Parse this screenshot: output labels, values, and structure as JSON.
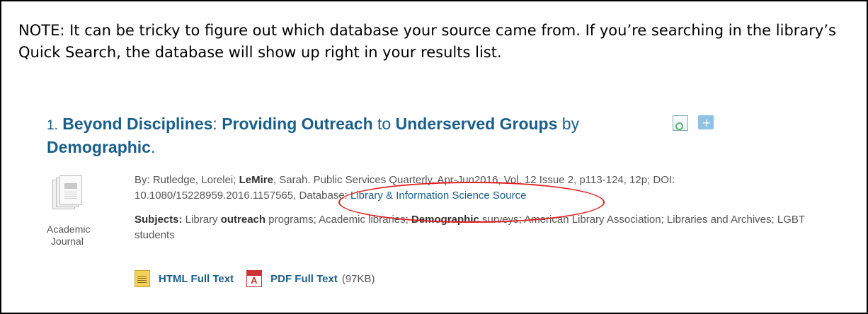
{
  "note": {
    "text": "NOTE:  It can be tricky to figure out which database your source came from.  If you’re searching in the library’s Quick Search, the database will show up right in your results list."
  },
  "result": {
    "number": "1.",
    "title_parts": [
      {
        "text": "Beyond Disciplines",
        "bold": true
      },
      {
        "text": ": ",
        "bold": false
      },
      {
        "text": "Providing Outreach",
        "bold": true
      },
      {
        "text": " to ",
        "bold": false
      },
      {
        "text": "Underserved Groups",
        "bold": true
      },
      {
        "text": " by ",
        "bold": false
      },
      {
        "text": "Demographic",
        "bold": true
      },
      {
        "text": ".",
        "bold": false
      }
    ],
    "publication_type": "Academic Journal",
    "by_label": "By: ",
    "author1": "Rutledge, Lorelei; ",
    "author2": "LeMire",
    "author2_rest": ", Sarah. Public Services Quarterly, Apr-Jun2016, Vol. 12 Issue 2, p113-124, 12p; DOI: 10.1080/15228959.2016.1157565, Database: ",
    "database": "Library & Information Science Source",
    "subjects_label": "Subjects:",
    "subjects_parts": [
      {
        "text": " Library ",
        "bold": false
      },
      {
        "text": "outreach",
        "bold": true
      },
      {
        "text": " programs; Academic libraries; ",
        "bold": false
      },
      {
        "text": "Demographic",
        "bold": true
      },
      {
        "text": " surveys; American Library Association; Libraries and Archives; LGBT students",
        "bold": false
      }
    ],
    "html_link": "HTML Full Text",
    "pdf_link": "PDF Full Text",
    "pdf_size": "(97KB)"
  },
  "annotation": {
    "color": "#e02020"
  },
  "colors": {
    "link": "#1a5e8a",
    "text": "#555555"
  }
}
